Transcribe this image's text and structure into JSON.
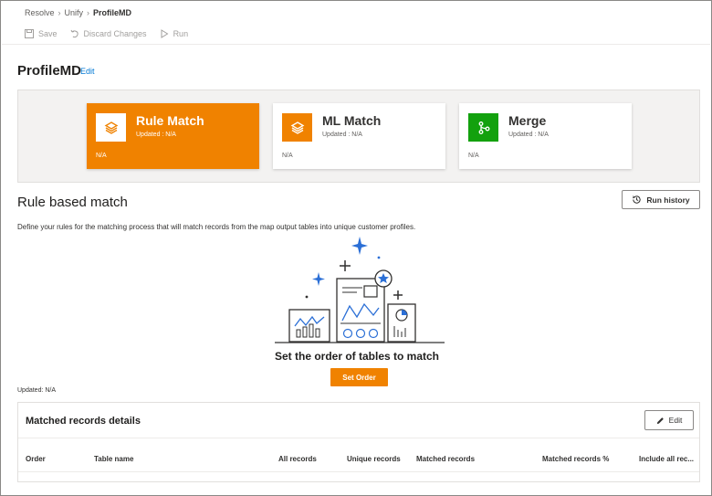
{
  "breadcrumb": {
    "items": [
      "Resolve",
      "Unify",
      "ProfileMD"
    ]
  },
  "commands": {
    "save": "Save",
    "discard": "Discard Changes",
    "run": "Run"
  },
  "page": {
    "title": "ProfileMD",
    "edit": "Edit"
  },
  "cards": [
    {
      "name": "Rule Match",
      "updated": "Updated : N/A",
      "status": "N/A",
      "icon": "layers-icon",
      "active": true
    },
    {
      "name": "ML Match",
      "updated": "Updated : N/A",
      "status": "N/A",
      "icon": "layers-icon",
      "active": false
    },
    {
      "name": "Merge",
      "updated": "Updated : N/A",
      "status": "N/A",
      "icon": "merge-icon",
      "active": false
    }
  ],
  "section": {
    "title": "Rule based match",
    "run_history": "Run history",
    "description": "Define your rules for the matching process that will match records from the map output tables into unique customer profiles."
  },
  "empty_state": {
    "title": "Set the order of tables to match",
    "button": "Set Order"
  },
  "updated_label": "Updated: N/A",
  "details": {
    "title": "Matched records details",
    "edit": "Edit",
    "columns": [
      "Order",
      "Table name",
      "All records",
      "Unique records",
      "Matched records",
      "Matched records %",
      "Include all rec..."
    ]
  },
  "colors": {
    "accent": "#f08200",
    "merge_green": "#13a10e",
    "link": "#0078d4",
    "illus_blue": "#2b6fd6"
  }
}
